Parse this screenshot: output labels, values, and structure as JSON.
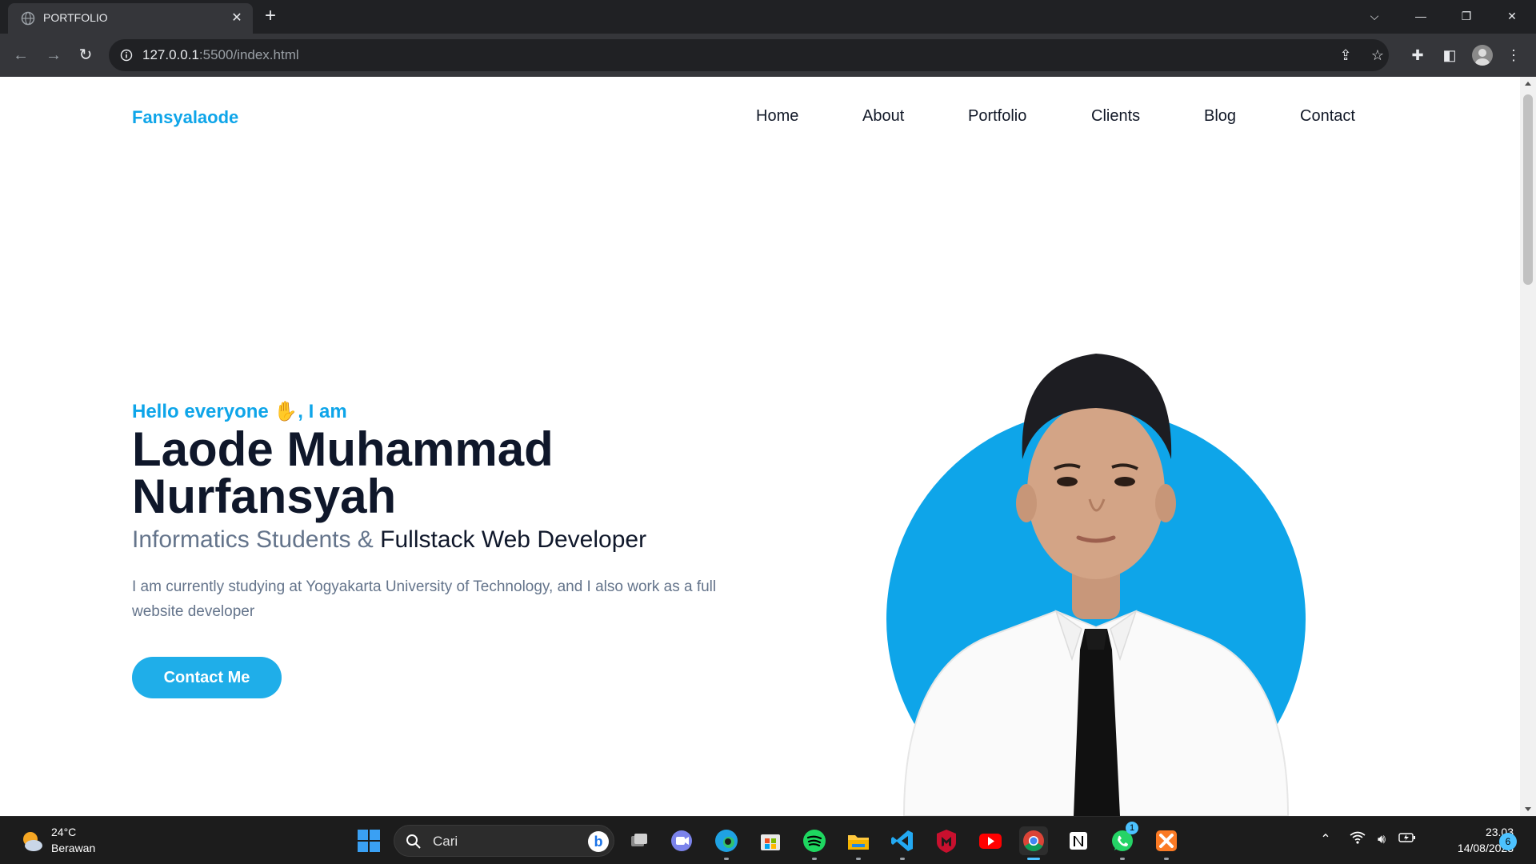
{
  "browser": {
    "tab_title": "PORTFOLIO",
    "url_host": "127.0.0.1",
    "url_rest": ":5500/index.html"
  },
  "site": {
    "brand": "Fansyalaode",
    "nav": [
      "Home",
      "About",
      "Portfolio",
      "Clients",
      "Blog",
      "Contact"
    ],
    "hero": {
      "greeting": "Hello everyone ✋, I am",
      "name": "Laode Muhammad Nurfansyah",
      "role_prefix": "Informatics Students & ",
      "role_main": "Fullstack Web Developer",
      "description": "I am currently studying at Yogyakarta University of Technology, and I also work as a full website developer",
      "cta": "Contact Me"
    }
  },
  "taskbar": {
    "weather_temp": "24°C",
    "weather_desc": "Berawan",
    "search_placeholder": "Cari",
    "whatsapp_badge": "1",
    "time": "23.03",
    "date": "14/08/2023",
    "notification_count": "6"
  },
  "colors": {
    "accent": "#0ea5e9",
    "heading": "#0f172a",
    "muted": "#64748b",
    "button": "#1faee9"
  }
}
